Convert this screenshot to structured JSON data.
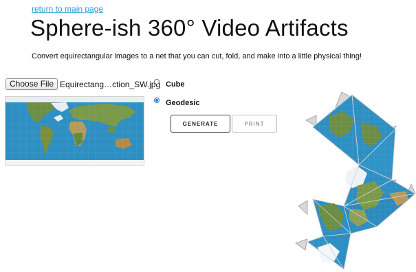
{
  "nav": {
    "back_link": "return to main page"
  },
  "header": {
    "title": "Sphere-ish 360° Video Artifacts",
    "subtitle": "Convert equirectangular images to a net that you can cut, fold, and make into a little physical thing!"
  },
  "file_input": {
    "button_label": "Choose File",
    "file_name": "Equirectang…ction_SW.jpg"
  },
  "shape_options": [
    {
      "label": "Cube",
      "selected": false
    },
    {
      "label": "Geodesic",
      "selected": true
    }
  ],
  "actions": {
    "generate_label": "GENERATE",
    "print_label": "PRINT"
  },
  "colors": {
    "link": "#2aa1d6",
    "ocean": "#2e8fc2",
    "land": "#6d8f45",
    "ice": "#eef3f6",
    "radio_selected": "#1a73e8"
  }
}
